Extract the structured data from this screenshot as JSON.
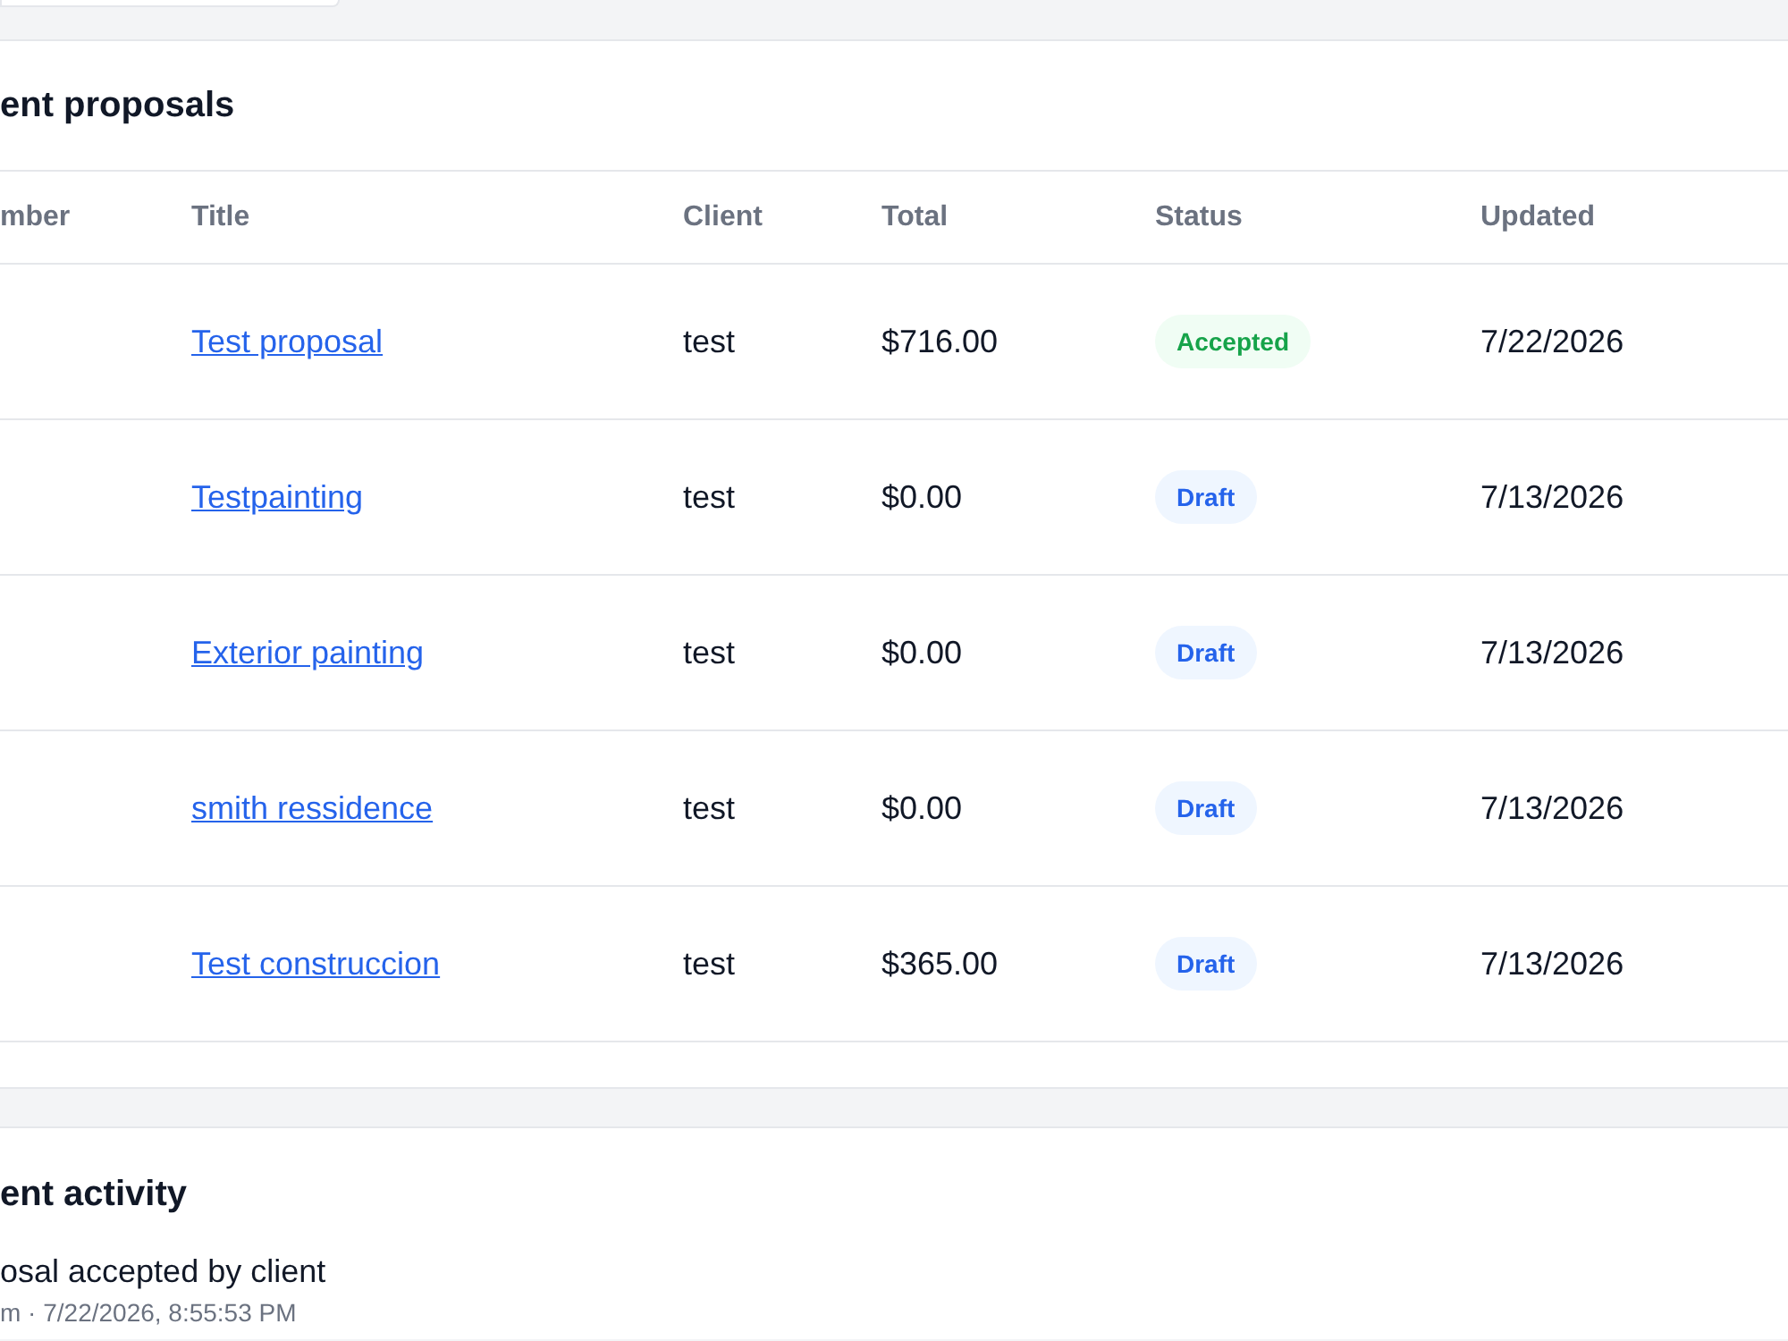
{
  "proposals": {
    "title": "ent proposals",
    "columns": [
      "mber",
      "Title",
      "Client",
      "Total",
      "Status",
      "Updated"
    ],
    "rows": [
      {
        "title": "Test proposal",
        "client": "test",
        "total": "$716.00",
        "status": {
          "label": "Accepted",
          "kind": "accepted"
        },
        "updated": "7/22/2026"
      },
      {
        "title": "Testpainting",
        "client": "test",
        "total": "$0.00",
        "status": {
          "label": "Draft",
          "kind": "draft"
        },
        "updated": "7/13/2026"
      },
      {
        "title": "Exterior painting",
        "client": "test",
        "total": "$0.00",
        "status": {
          "label": "Draft",
          "kind": "draft"
        },
        "updated": "7/13/2026"
      },
      {
        "title": "smith ressidence",
        "client": "test",
        "total": "$0.00",
        "status": {
          "label": "Draft",
          "kind": "draft"
        },
        "updated": "7/13/2026"
      },
      {
        "title": "Test construccion",
        "client": "test",
        "total": "$365.00",
        "status": {
          "label": "Draft",
          "kind": "draft"
        },
        "updated": "7/13/2026"
      }
    ]
  },
  "activity": {
    "title": "ent activity",
    "items": [
      {
        "text": "osal accepted by client",
        "meta": "m · 7/22/2026, 8:55:53 PM"
      }
    ]
  }
}
